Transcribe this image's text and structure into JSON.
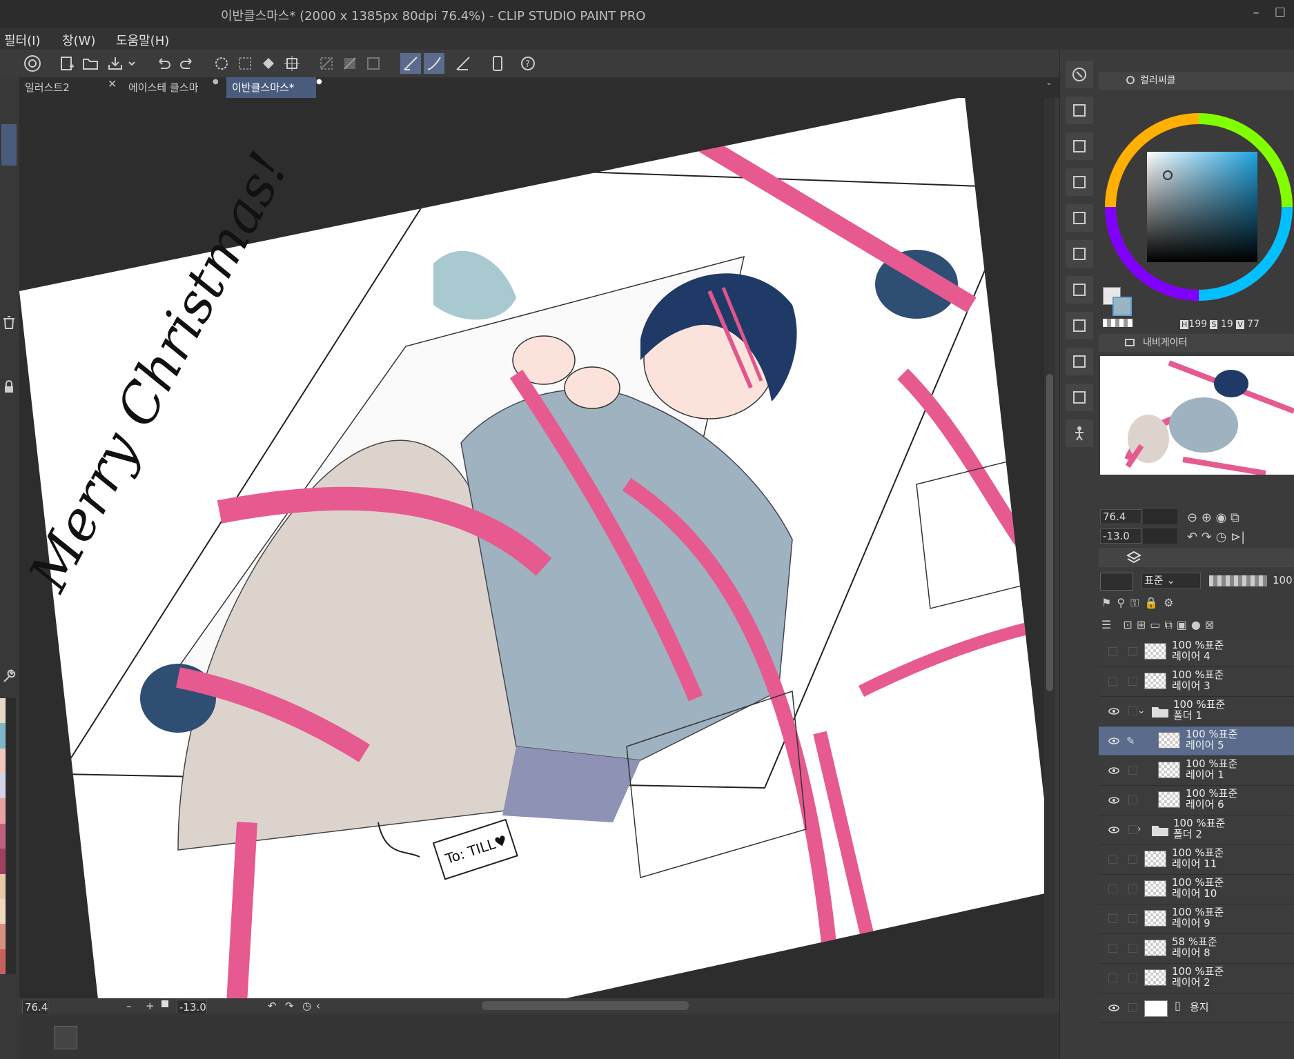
{
  "window": {
    "title": "이반클스마스* (2000 x 1385px 80dpi 76.4%)  - CLIP STUDIO PAINT PRO",
    "minimize": "–",
    "maximize": "☐"
  },
  "menu": [
    "필터(I)",
    "창(W)",
    "도움말(H)"
  ],
  "tabs": [
    {
      "label": "일러스트2",
      "close": "✕",
      "active": false
    },
    {
      "label": "에이스테 클스마",
      "close": "●",
      "active": false
    },
    {
      "label": "이반클스마스*",
      "close": "●",
      "active": true
    }
  ],
  "canvas": {
    "lettering": "Merry Christmas!",
    "tag_text": "To: TILL♥"
  },
  "bottom_bar": {
    "zoom": "76.4",
    "minus": "–",
    "plus": "+",
    "angle": "-13.0"
  },
  "color_panel": {
    "title": "컬러써클",
    "h_label": "H",
    "h_value": "199",
    "s_label": "S",
    "s_value": "19",
    "v_label": "V",
    "v_value": "77",
    "main_color": "#e8e8e8",
    "sub_color": "#9ab4c2"
  },
  "navigator": {
    "title": "내비게이터",
    "zoom": "76.4",
    "angle": "-13.0"
  },
  "layer_panel": {
    "blend_mode": "표준",
    "opacity": "100",
    "layers": [
      {
        "line1": "100 %표준",
        "line2": "레이어 4",
        "visible": false,
        "indent": 0,
        "type": "layer",
        "selected": false
      },
      {
        "line1": "100 %표준",
        "line2": "레이어 3",
        "visible": false,
        "indent": 0,
        "type": "layer",
        "selected": false
      },
      {
        "line1": "100 %표준",
        "line2": "폴더 1",
        "visible": true,
        "indent": 0,
        "type": "folder-open",
        "selected": false
      },
      {
        "line1": "100 %표준",
        "line2": "레이어 5",
        "visible": true,
        "indent": 1,
        "type": "layer",
        "selected": true
      },
      {
        "line1": "100 %표준",
        "line2": "레이어 1",
        "visible": true,
        "indent": 1,
        "type": "layer",
        "selected": false
      },
      {
        "line1": "100 %표준",
        "line2": "레이어 6",
        "visible": true,
        "indent": 1,
        "type": "layer",
        "selected": false
      },
      {
        "line1": "100 %표준",
        "line2": "폴더 2",
        "visible": true,
        "indent": 0,
        "type": "folder-closed",
        "selected": false
      },
      {
        "line1": "100 %표준",
        "line2": "레이어 11",
        "visible": false,
        "indent": 0,
        "type": "layer",
        "selected": false
      },
      {
        "line1": "100 %표준",
        "line2": "레이어 10",
        "visible": false,
        "indent": 0,
        "type": "layer",
        "selected": false
      },
      {
        "line1": "100 %표준",
        "line2": "레이어 9",
        "visible": false,
        "indent": 0,
        "type": "layer",
        "selected": false
      },
      {
        "line1": "58 %표준",
        "line2": "레이어 8",
        "visible": false,
        "indent": 0,
        "type": "layer",
        "selected": false
      },
      {
        "line1": "100 %표준",
        "line2": "레이어 2",
        "visible": false,
        "indent": 0,
        "type": "layer",
        "selected": false
      },
      {
        "line1": "",
        "line2": "용지",
        "visible": true,
        "indent": 0,
        "type": "paper",
        "selected": false
      }
    ]
  },
  "palette_swatches": [
    "#e8d6c4",
    "#7fb6c4",
    "#f0c8c0",
    "#d4d4e8",
    "#e8a0a0",
    "#c06080",
    "#a04060",
    "#e8c8a8",
    "#f0d8c0",
    "#d89080",
    "#c86060"
  ]
}
